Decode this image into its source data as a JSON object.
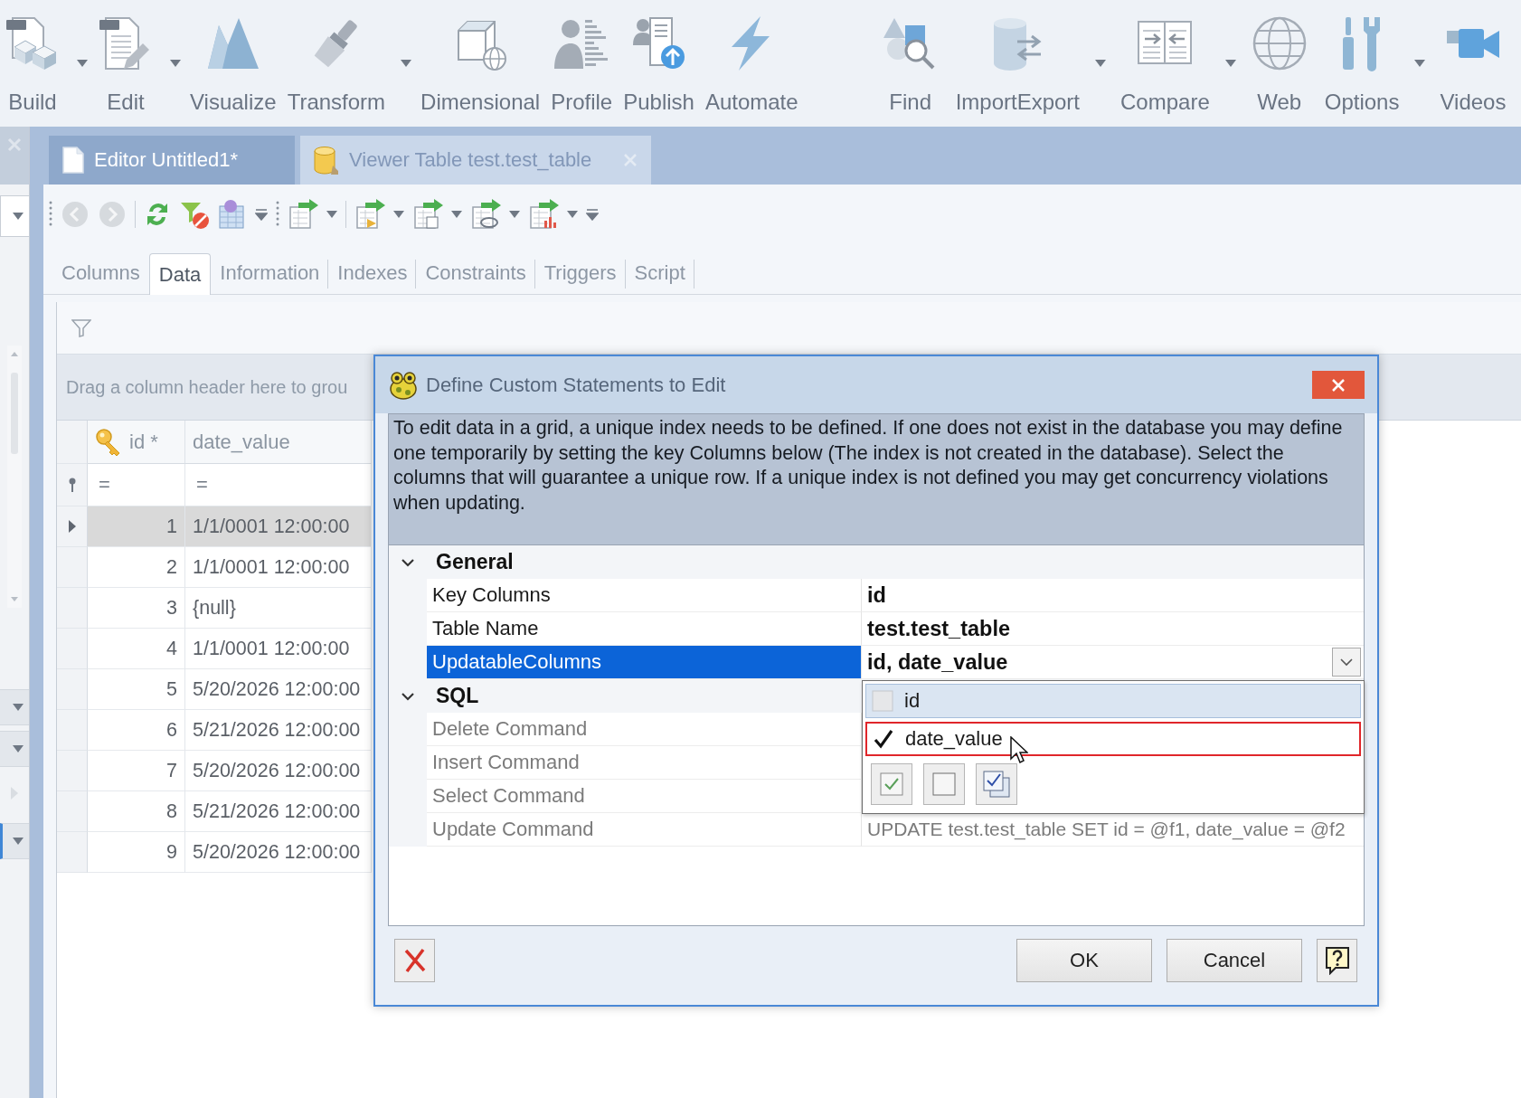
{
  "ribbon": {
    "groups": [
      {
        "items": [
          {
            "label": "Build",
            "dropdown": true
          },
          {
            "label": "Edit",
            "dropdown": true
          },
          {
            "label": "Visualize",
            "dropdown": false
          },
          {
            "label": "Transform",
            "dropdown": true
          },
          {
            "label": "Dimensional",
            "dropdown": false
          },
          {
            "label": "Profile",
            "dropdown": false
          },
          {
            "label": "Publish",
            "dropdown": false
          },
          {
            "label": "Automate",
            "dropdown": false
          }
        ]
      },
      {
        "items": [
          {
            "label": "Find",
            "dropdown": false
          },
          {
            "label": "ImportExport",
            "dropdown": true
          },
          {
            "label": "Compare",
            "dropdown": true
          },
          {
            "label": "Web",
            "dropdown": false
          },
          {
            "label": "Options",
            "dropdown": true
          },
          {
            "label": "Videos",
            "dropdown": false
          }
        ]
      }
    ]
  },
  "document_tabs": [
    {
      "label": "Editor Untitled1*",
      "selected": false
    },
    {
      "label": "Viewer Table test.test_table",
      "selected": true
    }
  ],
  "sub_tabs": [
    {
      "label": "Columns",
      "selected": false
    },
    {
      "label": "Data",
      "selected": true
    },
    {
      "label": "Information",
      "selected": false
    },
    {
      "label": "Indexes",
      "selected": false
    },
    {
      "label": "Constraints",
      "selected": false
    },
    {
      "label": "Triggers",
      "selected": false
    },
    {
      "label": "Script",
      "selected": false
    }
  ],
  "grid": {
    "group_panel_hint": "Drag a column header here to grou",
    "columns": [
      {
        "label": "id *",
        "key": true
      },
      {
        "label": "date_value",
        "key": false
      }
    ],
    "filter_row": [
      "=",
      "="
    ],
    "rows": [
      {
        "id": "1",
        "date_value": "1/1/0001 12:00:00",
        "selected": true
      },
      {
        "id": "2",
        "date_value": "1/1/0001 12:00:00",
        "selected": false
      },
      {
        "id": "3",
        "date_value": "{null}",
        "selected": false
      },
      {
        "id": "4",
        "date_value": "1/1/0001 12:00:00",
        "selected": false
      },
      {
        "id": "5",
        "date_value": "5/20/2026 12:00:00",
        "selected": false
      },
      {
        "id": "6",
        "date_value": "5/21/2026 12:00:00",
        "selected": false
      },
      {
        "id": "7",
        "date_value": "5/20/2026 12:00:00",
        "selected": false
      },
      {
        "id": "8",
        "date_value": "5/21/2026 12:00:00",
        "selected": false
      },
      {
        "id": "9",
        "date_value": "5/20/2026 12:00:00",
        "selected": false
      }
    ]
  },
  "dialog": {
    "title": "Define Custom Statements to Edit",
    "description": "To edit data in a grid, a unique index needs to be defined. If one does not exist in the database you may define one temporarily by setting the key Columns below (The index is not created in the database). Select the columns that will guarantee a unique row. If a unique index is not defined you may get concurrency violations when updating.",
    "categories": [
      {
        "name": "General",
        "expanded": true,
        "properties": [
          {
            "name": "Key Columns",
            "value": "id",
            "readonly": false,
            "selected": false
          },
          {
            "name": "Table Name",
            "value": "test.test_table",
            "readonly": false,
            "selected": false
          },
          {
            "name": "UpdatableColumns",
            "value": "id, date_value",
            "readonly": false,
            "selected": true
          }
        ]
      },
      {
        "name": "SQL",
        "expanded": true,
        "properties": [
          {
            "name": "Delete Command",
            "readonly": true,
            "selected": false
          },
          {
            "name": "Insert Command",
            "readonly": true,
            "selected": false
          },
          {
            "name": "Select Command",
            "readonly": true,
            "selected": false
          },
          {
            "name": "Update Command",
            "value": "UPDATE test.test_table SET id = @f1, date_value = @f2",
            "readonly": true,
            "selected": false
          }
        ]
      }
    ],
    "dropdown_list": {
      "items": [
        {
          "label": "id",
          "checked": false,
          "selected": true,
          "hovered": false
        },
        {
          "label": "date_value",
          "checked": true,
          "selected": false,
          "hovered": true
        }
      ]
    },
    "buttons": [
      {
        "label": "OK"
      },
      {
        "label": "Cancel"
      }
    ]
  }
}
